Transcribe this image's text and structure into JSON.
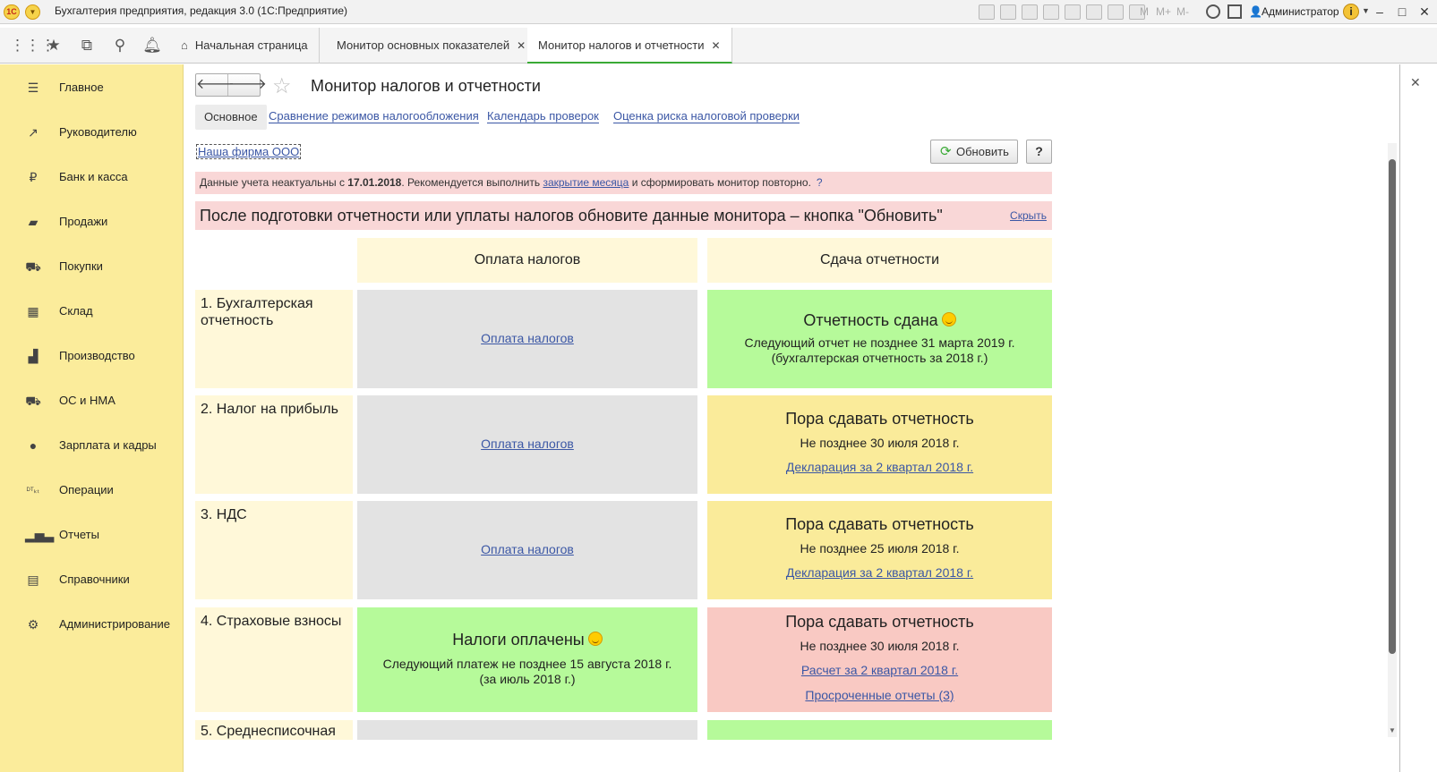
{
  "titlebar": {
    "logo": "1С",
    "title": "Бухгалтерия предприятия, редакция 3.0  (1С:Предприятие)",
    "m_labels": [
      "M",
      "M+",
      "M-"
    ],
    "user": "Администратор",
    "info": "i"
  },
  "tabbar": {
    "tabs": [
      {
        "label": "Начальная страница"
      },
      {
        "label": "Монитор основных показателей"
      },
      {
        "label": "Монитор налогов и отчетности"
      }
    ]
  },
  "sidebar": {
    "items": [
      {
        "label": "Главное",
        "icon": "menu-icon"
      },
      {
        "label": "Руководителю",
        "icon": "trend-icon"
      },
      {
        "label": "Банк и касса",
        "icon": "ruble-icon"
      },
      {
        "label": "Продажи",
        "icon": "bag-icon"
      },
      {
        "label": "Покупки",
        "icon": "cart-icon"
      },
      {
        "label": "Склад",
        "icon": "grid-icon"
      },
      {
        "label": "Производство",
        "icon": "factory-icon"
      },
      {
        "label": "ОС и НМА",
        "icon": "truck-icon"
      },
      {
        "label": "Зарплата и кадры",
        "icon": "person-icon"
      },
      {
        "label": "Операции",
        "icon": "dt-kt-icon"
      },
      {
        "label": "Отчеты",
        "icon": "bar-chart-icon"
      },
      {
        "label": "Справочники",
        "icon": "book-icon"
      },
      {
        "label": "Администрирование",
        "icon": "gear-icon"
      }
    ]
  },
  "form": {
    "title": "Монитор налогов и отчетности",
    "subtabs": {
      "main": "Основное",
      "links": [
        "Сравнение режимов налогообложения",
        "Календарь проверок",
        "Оценка риска налоговой проверки"
      ]
    },
    "organization": "Наша фирма ООО",
    "refresh_label": "Обновить",
    "help_label": "?",
    "warning": {
      "prefix": "Данные учета неактуальны с ",
      "date": "17.01.2018",
      "mid": ". Рекомендуется выполнить ",
      "link": "закрытие месяца",
      "suffix": " и сформировать монитор повторно.",
      "help": "?"
    },
    "hint": {
      "text": "После подготовки отчетности или уплаты налогов обновите данные монитора – кнопка \"Обновить\"",
      "hide": "Скрыть"
    },
    "columns": [
      "Оплата налогов",
      "Сдача отчетности"
    ],
    "rows": [
      {
        "label": "1. Бухгалтерская отчетность",
        "payment": {
          "link": "Оплата налогов"
        },
        "report": {
          "title": "Отчетность сдана",
          "line1": "Следующий отчет не позднее 31 марта 2019 г.",
          "line2": "(бухгалтерская отчетность за 2018 г.)"
        }
      },
      {
        "label": "2. Налог на прибыль",
        "payment": {
          "link": "Оплата налогов"
        },
        "report": {
          "title": "Пора сдавать отчетность",
          "line1": "Не позднее 30 июля 2018 г.",
          "link": "Декларация за 2 квартал 2018 г."
        }
      },
      {
        "label": "3. НДС",
        "payment": {
          "link": "Оплата налогов"
        },
        "report": {
          "title": "Пора сдавать отчетность",
          "line1": "Не позднее 25 июля 2018 г.",
          "link": "Декларация за 2 квартал 2018 г."
        }
      },
      {
        "label": "4. Страховые взносы",
        "payment": {
          "title": "Налоги оплачены",
          "line1": "Следующий платеж не позднее 15 августа 2018 г.",
          "line2": "(за июль 2018 г.)"
        },
        "report": {
          "title": "Пора сдавать отчетность",
          "line1": "Не позднее 30 июля 2018 г.",
          "link": "Расчет за 2 квартал 2018 г.",
          "link2": "Просроченные отчеты (3)"
        }
      },
      {
        "label": "5. Среднесписочная"
      }
    ]
  },
  "colors": {
    "sidebar": "#fbec9b",
    "gray_cell": "#e3e3e3",
    "green_cell": "#b6fa9a",
    "yellow_cell": "#faeb9a",
    "red_cell": "#f9c9c3",
    "link": "#3b57a5",
    "accent": "#3aaa35"
  }
}
